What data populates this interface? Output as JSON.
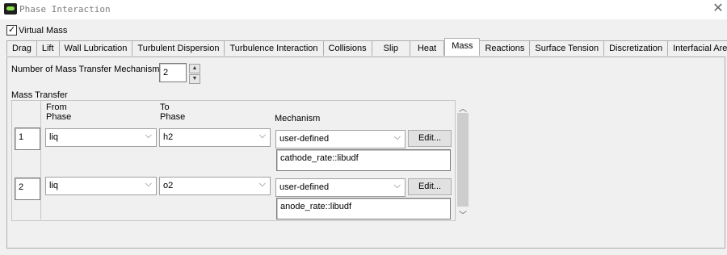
{
  "window": {
    "title": "Phase Interaction",
    "close_symbol": "✕"
  },
  "virtual_mass": {
    "label": "Virtual Mass",
    "checked": true
  },
  "tabs": [
    {
      "label": "Drag"
    },
    {
      "label": "Lift"
    },
    {
      "label": "Wall Lubrication"
    },
    {
      "label": "Turbulent Dispersion"
    },
    {
      "label": "Turbulence Interaction"
    },
    {
      "label": "Collisions"
    },
    {
      "label": "Slip"
    },
    {
      "label": "Heat"
    },
    {
      "label": "Mass",
      "active": true
    },
    {
      "label": "Reactions"
    },
    {
      "label": "Surface Tension"
    },
    {
      "label": "Discretization"
    },
    {
      "label": "Interfacial Area"
    }
  ],
  "mass": {
    "num_mechanisms_label": "Number of Mass Transfer Mechanisms",
    "num_mechanisms_value": "2",
    "group_label": "Mass Transfer",
    "headers": {
      "from_line1": "From",
      "from_line2": "Phase",
      "to_line1": "To",
      "to_line2": "Phase",
      "mechanism": "Mechanism"
    },
    "edit_label": "Edit...",
    "rows": [
      {
        "index": "1",
        "from": "liq",
        "to": "h2",
        "mechanism": "user-defined",
        "udf": "cathode_rate::libudf"
      },
      {
        "index": "2",
        "from": "liq",
        "to": "o2",
        "mechanism": "user-defined",
        "udf": "anode_rate::libudf"
      }
    ]
  }
}
